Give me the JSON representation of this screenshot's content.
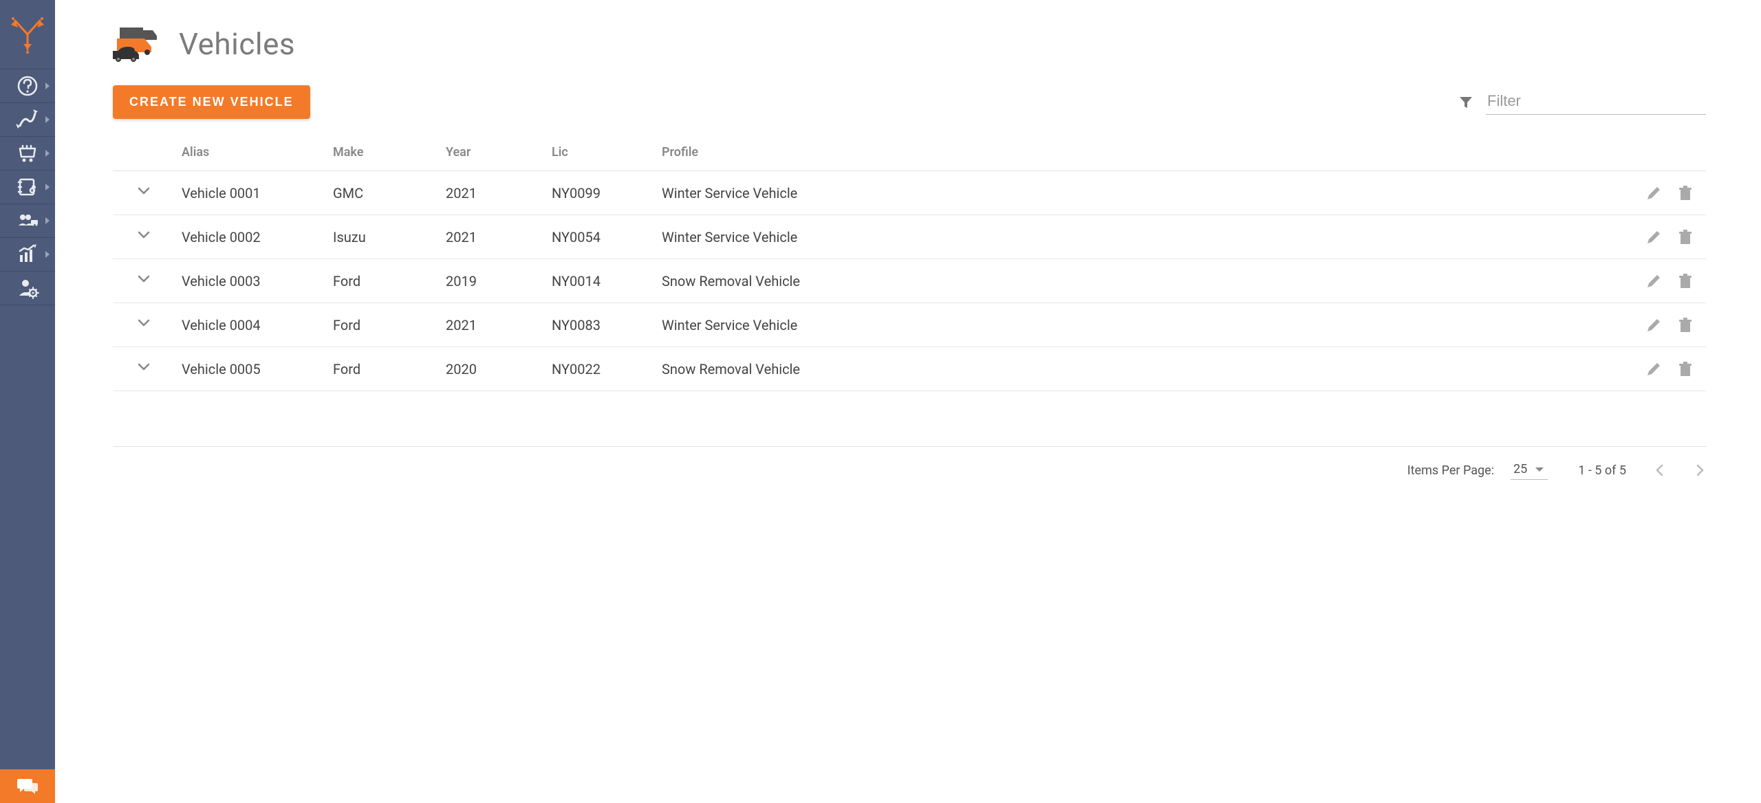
{
  "page": {
    "title": "Vehicles",
    "create_button": "CREATE NEW VEHICLE",
    "filter_placeholder": "Filter"
  },
  "sidebar": {
    "items": [
      {
        "name": "help-icon"
      },
      {
        "name": "routes-icon"
      },
      {
        "name": "orders-icon"
      },
      {
        "name": "contacts-icon"
      },
      {
        "name": "team-icon"
      },
      {
        "name": "analytics-icon"
      },
      {
        "name": "user-settings-icon"
      }
    ]
  },
  "table": {
    "headers": {
      "alias": "Alias",
      "make": "Make",
      "year": "Year",
      "lic": "Lic",
      "profile": "Profile"
    },
    "rows": [
      {
        "alias": "Vehicle 0001",
        "make": "GMC",
        "year": "2021",
        "lic": "NY0099",
        "profile": "Winter Service Vehicle"
      },
      {
        "alias": "Vehicle 0002",
        "make": "Isuzu",
        "year": "2021",
        "lic": "NY0054",
        "profile": "Winter Service Vehicle"
      },
      {
        "alias": "Vehicle 0003",
        "make": "Ford",
        "year": "2019",
        "lic": "NY0014",
        "profile": "Snow Removal Vehicle"
      },
      {
        "alias": "Vehicle 0004",
        "make": "Ford",
        "year": "2021",
        "lic": "NY0083",
        "profile": "Winter Service Vehicle"
      },
      {
        "alias": "Vehicle 0005",
        "make": "Ford",
        "year": "2020",
        "lic": "NY0022",
        "profile": "Snow Removal Vehicle"
      }
    ]
  },
  "pagination": {
    "items_per_page_label": "Items Per Page:",
    "items_per_page_value": "25",
    "range_text": "1 - 5 of 5"
  },
  "colors": {
    "accent": "#f37a29",
    "sidebar_bg": "#4d5a7a"
  }
}
